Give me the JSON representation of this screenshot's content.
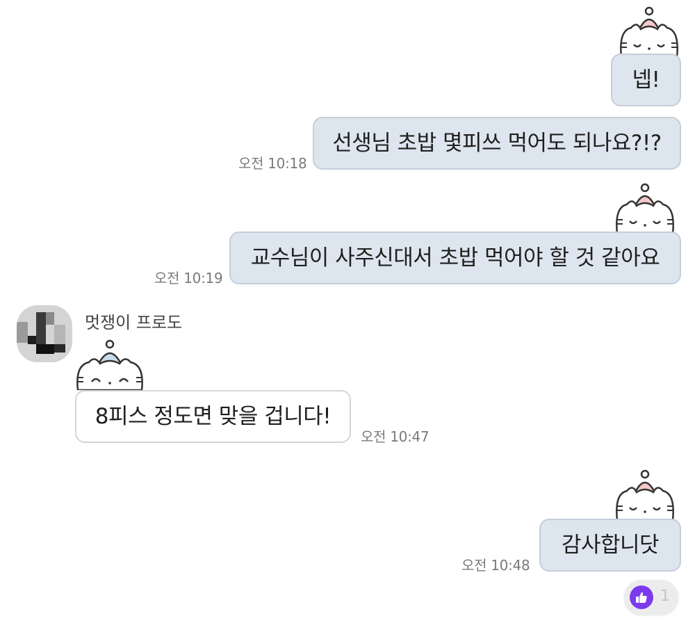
{
  "messages": [
    {
      "text": "넵!",
      "time": ""
    },
    {
      "text": "선생님 초밥 몇피쓰 먹어도 되나요?!?",
      "time": "오전 10:18"
    },
    {
      "text": "교수님이 사주신대서 초밥 먹어야 할 것 같아요",
      "time": "오전 10:19"
    },
    {
      "sender": "멋쟁이 프로도",
      "text": "8피스 정도면 맞을 겁니다!",
      "time": "오전 10:47"
    },
    {
      "text": "감사합니닷",
      "time": "오전 10:48"
    }
  ],
  "reaction": {
    "icon": "thumbs-up-icon",
    "count": "1",
    "color": "#7c3aed"
  },
  "colors": {
    "my_bubble": "#dde5ee",
    "their_bubble": "#ffffff",
    "cat_hat_mine": "#f4c9c9",
    "cat_hat_theirs": "#c9dcef"
  }
}
